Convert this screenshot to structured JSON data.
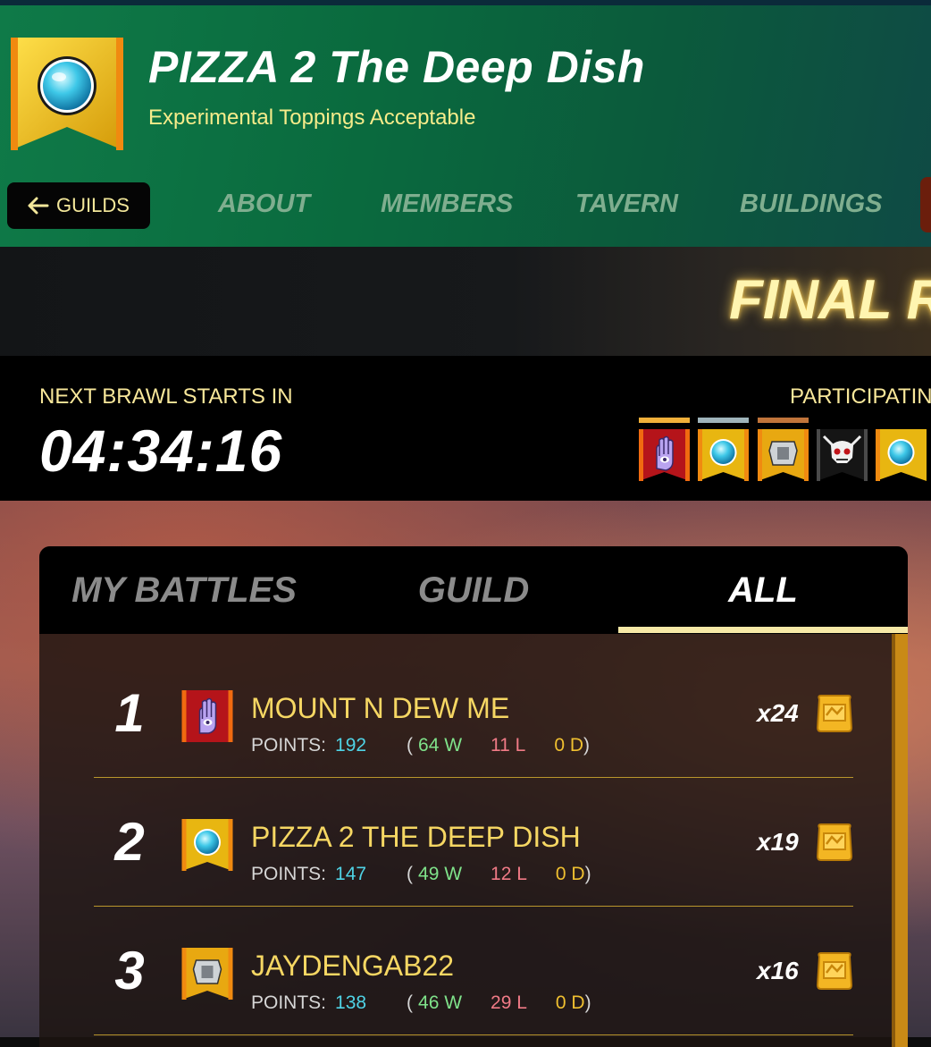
{
  "header": {
    "guild_name": "PIZZA 2 The Deep Dish",
    "motto": "Experimental Toppings Acceptable",
    "back_label": "GUILDS",
    "tabs": [
      {
        "label": "ABOUT"
      },
      {
        "label": "MEMBERS"
      },
      {
        "label": "TAVERN"
      },
      {
        "label": "BUILDINGS"
      }
    ]
  },
  "hero": {
    "title": "FINAL RI"
  },
  "brawl": {
    "next_label": "NEXT BRAWL STARTS IN",
    "countdown": "04:34:16",
    "participants_label": "PARTICIPATIN",
    "participants": [
      {
        "icon": "hand-eye-icon",
        "banner_color": "#b5141a",
        "rank_color": "#f0b03a"
      },
      {
        "icon": "orb-icon",
        "banner_color": "#e8b611",
        "rank_color": "#9fb4bb"
      },
      {
        "icon": "armor-icon",
        "banner_color": "#e8a811",
        "rank_color": "#c0743a"
      },
      {
        "icon": "skull-icon",
        "banner_color": "#141414",
        "rank_color": ""
      },
      {
        "icon": "orb-icon",
        "banner_color": "#e8b611",
        "rank_color": ""
      }
    ]
  },
  "leaderboard": {
    "tabs": [
      {
        "label": "MY BATTLES",
        "active": false
      },
      {
        "label": "GUILD",
        "active": false
      },
      {
        "label": "ALL",
        "active": true
      }
    ],
    "points_label": "POINTS:",
    "rows": [
      {
        "rank": "1",
        "name": "MOUNT N DEW ME",
        "points": "192",
        "wins": "64 W",
        "losses": "11 L",
        "draws": "0 D",
        "multiplier": "x24",
        "icon": "hand-eye-icon"
      },
      {
        "rank": "2",
        "name": "PIZZA 2 THE DEEP DISH",
        "points": "147",
        "wins": "49 W",
        "losses": "12 L",
        "draws": "0 D",
        "multiplier": "x19",
        "icon": "orb-icon"
      },
      {
        "rank": "3",
        "name": "JAYDENGAB22",
        "points": "138",
        "wins": "46 W",
        "losses": "29 L",
        "draws": "0 D",
        "multiplier": "x16",
        "icon": "armor-icon"
      }
    ],
    "paren_open": "(",
    "paren_close": ")"
  },
  "colors": {
    "accent_gold": "#f6d763",
    "points_cyan": "#4fd3e6",
    "wins_green": "#7fe28a",
    "losses_red": "#f07a86",
    "draws_yellow": "#f0c030"
  }
}
